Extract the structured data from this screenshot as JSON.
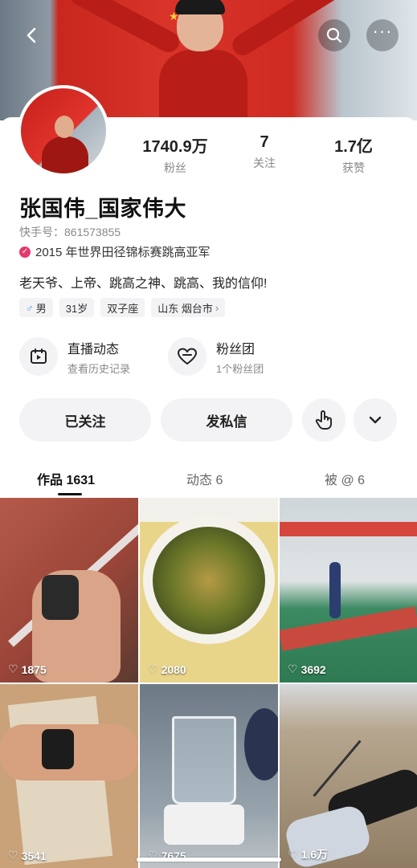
{
  "profile": {
    "name": "张国伟_国家伟大",
    "kuaishou_id": "快手号：861573855",
    "certification": "2015 年世界田径锦标赛跳高亚军",
    "bio": "老天爷、上帝、跳高之神、跳高、我的信仰!"
  },
  "stats": [
    {
      "value": "1740.9万",
      "label": "粉丝"
    },
    {
      "value": "7",
      "label": "关注"
    },
    {
      "value": "1.7亿",
      "label": "获赞"
    }
  ],
  "tags": {
    "gender": "男",
    "age": "31岁",
    "zodiac": "双子座",
    "location": "山东 烟台市"
  },
  "features": {
    "live": {
      "title": "直播动态",
      "subtitle": "查看历史记录"
    },
    "fans": {
      "title": "粉丝团",
      "subtitle": "1个粉丝团"
    }
  },
  "actions": {
    "followed": "已关注",
    "message": "发私信"
  },
  "tabs": [
    {
      "label": "作品 1631"
    },
    {
      "label": "动态 6"
    },
    {
      "label": "被 @ 6"
    }
  ],
  "grid": [
    {
      "likes": "1875",
      "icon": "stopwatch-hand"
    },
    {
      "likes": "2080",
      "icon": "soup-bowl"
    },
    {
      "likes": "3692",
      "icon": "indoor-track"
    },
    {
      "likes": "3541",
      "icon": "wrist-watch-box"
    },
    {
      "likes": "7675",
      "icon": "glass-beaker"
    },
    {
      "likes": "1.6万",
      "icon": "lying-golfer"
    }
  ],
  "colors": {
    "accent": "#e4396b",
    "male": "#4a90e2",
    "text": "#222222",
    "muted": "#888888"
  }
}
